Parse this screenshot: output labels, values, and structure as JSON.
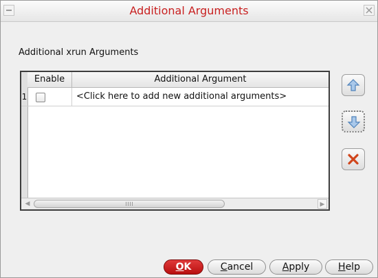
{
  "window": {
    "title": "Additional Arguments",
    "menu_icon": "window-menu-icon",
    "close_icon": "close-icon"
  },
  "heading": "Additional xrun Arguments",
  "table": {
    "columns": [
      "Enable",
      "Additional Argument"
    ],
    "rows": [
      {
        "row_number": "1",
        "enabled": false,
        "argument": "<Click here to add new additional arguments>"
      }
    ]
  },
  "side_buttons": {
    "move_up_icon": "arrow-up-icon",
    "move_down_icon": "arrow-down-icon",
    "delete_icon": "delete-x-icon"
  },
  "footer": {
    "ok": {
      "mnemonic": "O",
      "rest": "K"
    },
    "cancel": {
      "mnemonic": "C",
      "rest": "ancel"
    },
    "apply": {
      "mnemonic": "A",
      "rest": "pply"
    },
    "help": {
      "mnemonic": "H",
      "rest": "elp"
    }
  },
  "colors": {
    "title": "#c82020",
    "ok_button": "#c81a1a",
    "arrow_blue": "#5a8fc8",
    "delete_orange": "#d0451b"
  }
}
